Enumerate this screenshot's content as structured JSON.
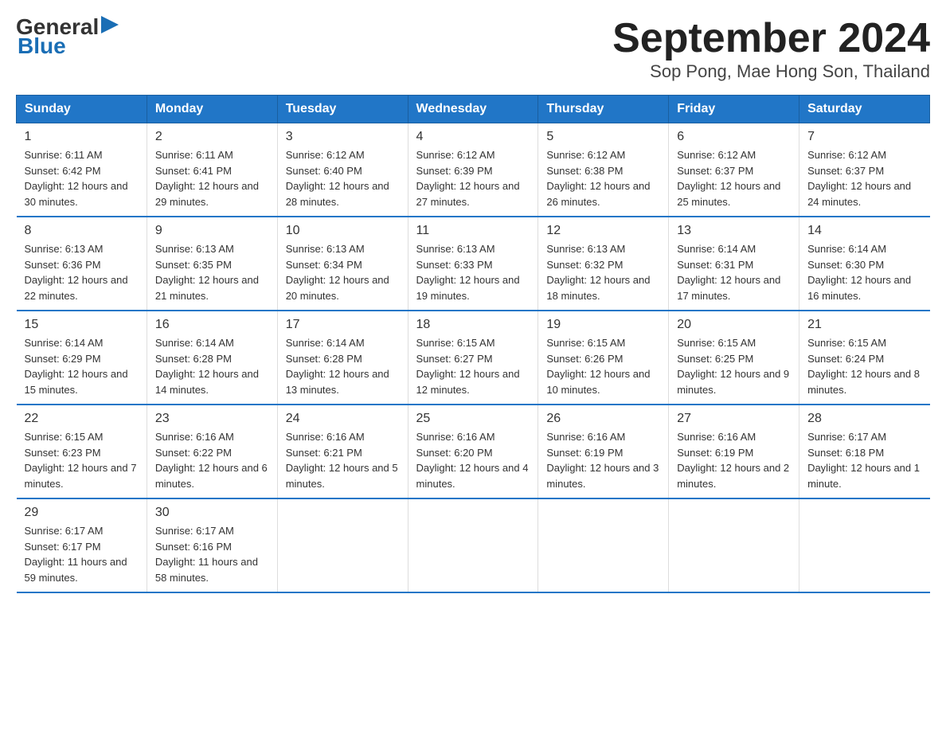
{
  "logo": {
    "text_general": "General",
    "text_blue": "Blue",
    "arrow_symbol": "▶"
  },
  "title": "September 2024",
  "subtitle": "Sop Pong, Mae Hong Son, Thailand",
  "days_of_week": [
    "Sunday",
    "Monday",
    "Tuesday",
    "Wednesday",
    "Thursday",
    "Friday",
    "Saturday"
  ],
  "weeks": [
    [
      {
        "num": "1",
        "sunrise": "6:11 AM",
        "sunset": "6:42 PM",
        "daylight": "12 hours and 30 minutes."
      },
      {
        "num": "2",
        "sunrise": "6:11 AM",
        "sunset": "6:41 PM",
        "daylight": "12 hours and 29 minutes."
      },
      {
        "num": "3",
        "sunrise": "6:12 AM",
        "sunset": "6:40 PM",
        "daylight": "12 hours and 28 minutes."
      },
      {
        "num": "4",
        "sunrise": "6:12 AM",
        "sunset": "6:39 PM",
        "daylight": "12 hours and 27 minutes."
      },
      {
        "num": "5",
        "sunrise": "6:12 AM",
        "sunset": "6:38 PM",
        "daylight": "12 hours and 26 minutes."
      },
      {
        "num": "6",
        "sunrise": "6:12 AM",
        "sunset": "6:37 PM",
        "daylight": "12 hours and 25 minutes."
      },
      {
        "num": "7",
        "sunrise": "6:12 AM",
        "sunset": "6:37 PM",
        "daylight": "12 hours and 24 minutes."
      }
    ],
    [
      {
        "num": "8",
        "sunrise": "6:13 AM",
        "sunset": "6:36 PM",
        "daylight": "12 hours and 22 minutes."
      },
      {
        "num": "9",
        "sunrise": "6:13 AM",
        "sunset": "6:35 PM",
        "daylight": "12 hours and 21 minutes."
      },
      {
        "num": "10",
        "sunrise": "6:13 AM",
        "sunset": "6:34 PM",
        "daylight": "12 hours and 20 minutes."
      },
      {
        "num": "11",
        "sunrise": "6:13 AM",
        "sunset": "6:33 PM",
        "daylight": "12 hours and 19 minutes."
      },
      {
        "num": "12",
        "sunrise": "6:13 AM",
        "sunset": "6:32 PM",
        "daylight": "12 hours and 18 minutes."
      },
      {
        "num": "13",
        "sunrise": "6:14 AM",
        "sunset": "6:31 PM",
        "daylight": "12 hours and 17 minutes."
      },
      {
        "num": "14",
        "sunrise": "6:14 AM",
        "sunset": "6:30 PM",
        "daylight": "12 hours and 16 minutes."
      }
    ],
    [
      {
        "num": "15",
        "sunrise": "6:14 AM",
        "sunset": "6:29 PM",
        "daylight": "12 hours and 15 minutes."
      },
      {
        "num": "16",
        "sunrise": "6:14 AM",
        "sunset": "6:28 PM",
        "daylight": "12 hours and 14 minutes."
      },
      {
        "num": "17",
        "sunrise": "6:14 AM",
        "sunset": "6:28 PM",
        "daylight": "12 hours and 13 minutes."
      },
      {
        "num": "18",
        "sunrise": "6:15 AM",
        "sunset": "6:27 PM",
        "daylight": "12 hours and 12 minutes."
      },
      {
        "num": "19",
        "sunrise": "6:15 AM",
        "sunset": "6:26 PM",
        "daylight": "12 hours and 10 minutes."
      },
      {
        "num": "20",
        "sunrise": "6:15 AM",
        "sunset": "6:25 PM",
        "daylight": "12 hours and 9 minutes."
      },
      {
        "num": "21",
        "sunrise": "6:15 AM",
        "sunset": "6:24 PM",
        "daylight": "12 hours and 8 minutes."
      }
    ],
    [
      {
        "num": "22",
        "sunrise": "6:15 AM",
        "sunset": "6:23 PM",
        "daylight": "12 hours and 7 minutes."
      },
      {
        "num": "23",
        "sunrise": "6:16 AM",
        "sunset": "6:22 PM",
        "daylight": "12 hours and 6 minutes."
      },
      {
        "num": "24",
        "sunrise": "6:16 AM",
        "sunset": "6:21 PM",
        "daylight": "12 hours and 5 minutes."
      },
      {
        "num": "25",
        "sunrise": "6:16 AM",
        "sunset": "6:20 PM",
        "daylight": "12 hours and 4 minutes."
      },
      {
        "num": "26",
        "sunrise": "6:16 AM",
        "sunset": "6:19 PM",
        "daylight": "12 hours and 3 minutes."
      },
      {
        "num": "27",
        "sunrise": "6:16 AM",
        "sunset": "6:19 PM",
        "daylight": "12 hours and 2 minutes."
      },
      {
        "num": "28",
        "sunrise": "6:17 AM",
        "sunset": "6:18 PM",
        "daylight": "12 hours and 1 minute."
      }
    ],
    [
      {
        "num": "29",
        "sunrise": "6:17 AM",
        "sunset": "6:17 PM",
        "daylight": "11 hours and 59 minutes."
      },
      {
        "num": "30",
        "sunrise": "6:17 AM",
        "sunset": "6:16 PM",
        "daylight": "11 hours and 58 minutes."
      },
      null,
      null,
      null,
      null,
      null
    ]
  ]
}
